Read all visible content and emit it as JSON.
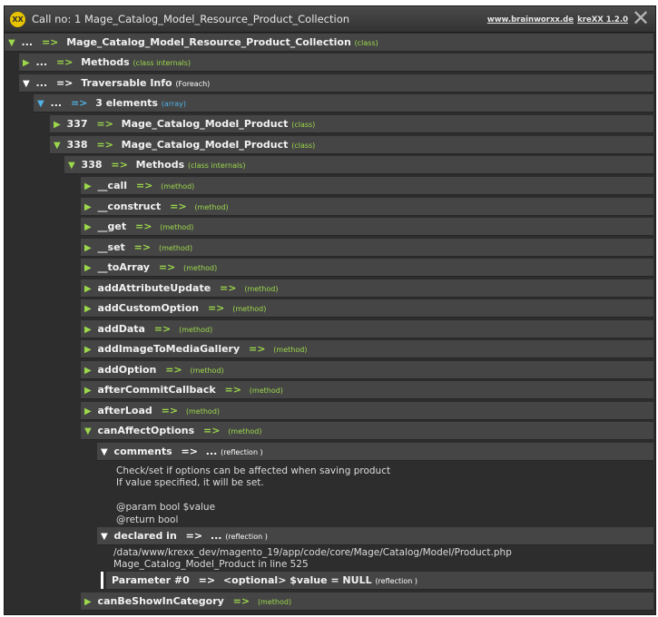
{
  "header": {
    "logo_text": "XX",
    "title": "Call no: 1 Mage_Catalog_Model_Resource_Product_Collection",
    "site_link": "www.brainworxx.de",
    "version_link": "kreXX 1.2.0",
    "close_symbol": "✕"
  },
  "rows": {
    "root": {
      "name": "...",
      "conn": "=>",
      "value": "Mage_Catalog_Model_Resource_Product_Collection",
      "type": "(class)"
    },
    "methods_top": {
      "name": "...",
      "conn": "=>",
      "value": "Methods",
      "type": "(class internals)"
    },
    "traversable": {
      "name": "...",
      "conn": "=>",
      "value": "Traversable Info",
      "type": "(Foreach)"
    },
    "elements": {
      "name": "...",
      "conn": "=>",
      "value": "3 elements",
      "type": "(array)"
    },
    "item337": {
      "name": "337",
      "conn": "=>",
      "value": "Mage_Catalog_Model_Product",
      "type": "(class)"
    },
    "item338": {
      "name": "338",
      "conn": "=>",
      "value": "Mage_Catalog_Model_Product",
      "type": "(class)"
    },
    "methods338": {
      "name": "338",
      "conn": "=>",
      "value": "Methods",
      "type": "(class internals)"
    },
    "m_call": {
      "name": "__call",
      "conn": "=>",
      "type": "(method)"
    },
    "m_construct": {
      "name": "__construct",
      "conn": "=>",
      "type": "(method)"
    },
    "m_get": {
      "name": "__get",
      "conn": "=>",
      "type": "(method)"
    },
    "m_set": {
      "name": "__set",
      "conn": "=>",
      "type": "(method)"
    },
    "m_toarray": {
      "name": "__toArray",
      "conn": "=>",
      "type": "(method)"
    },
    "m_addattr": {
      "name": "addAttributeUpdate",
      "conn": "=>",
      "type": "(method)"
    },
    "m_addcustom": {
      "name": "addCustomOption",
      "conn": "=>",
      "type": "(method)"
    },
    "m_adddata": {
      "name": "addData",
      "conn": "=>",
      "type": "(method)"
    },
    "m_addimage": {
      "name": "addImageToMediaGallery",
      "conn": "=>",
      "type": "(method)"
    },
    "m_addoption": {
      "name": "addOption",
      "conn": "=>",
      "type": "(method)"
    },
    "m_aftercommit": {
      "name": "afterCommitCallback",
      "conn": "=>",
      "type": "(method)"
    },
    "m_afterload": {
      "name": "afterLoad",
      "conn": "=>",
      "type": "(method)"
    },
    "m_canaffect": {
      "name": "canAffectOptions",
      "conn": "=>",
      "type": "(method)"
    },
    "comments": {
      "name": "comments",
      "conn": "=>",
      "dots": "...",
      "type": "(reflection )"
    },
    "declared": {
      "name": "declared in",
      "conn": "=>",
      "dots": "...",
      "type": "(reflection )"
    },
    "param0": {
      "name": "Parameter #0",
      "conn": "=>",
      "value": "<optional> $value = NULL",
      "type": "(reflection )"
    },
    "m_canbeshow": {
      "name": "canBeShowInCategory",
      "conn": "=>",
      "type": "(method)"
    }
  },
  "comment_text": {
    "line1": "Check/set if options can be affected when saving product",
    "line2": "If value specified, it will be set.",
    "line3": "@param   bool $value",
    "line4": "@return  bool"
  },
  "declared_text": {
    "line1": "/data/www/krexx_dev/magento_19/app/code/core/Mage/Catalog/Model/Product.php",
    "line2": "Mage_Catalog_Model_Product in line 525"
  },
  "colors": {
    "background": "#2d2d2d",
    "row": "#454545",
    "connector_green": "#9cd84b",
    "connector_blue": "#4fb3e6",
    "logo": "#e8c400"
  },
  "icons": {
    "collapsed": "▶",
    "expanded": "▼"
  }
}
